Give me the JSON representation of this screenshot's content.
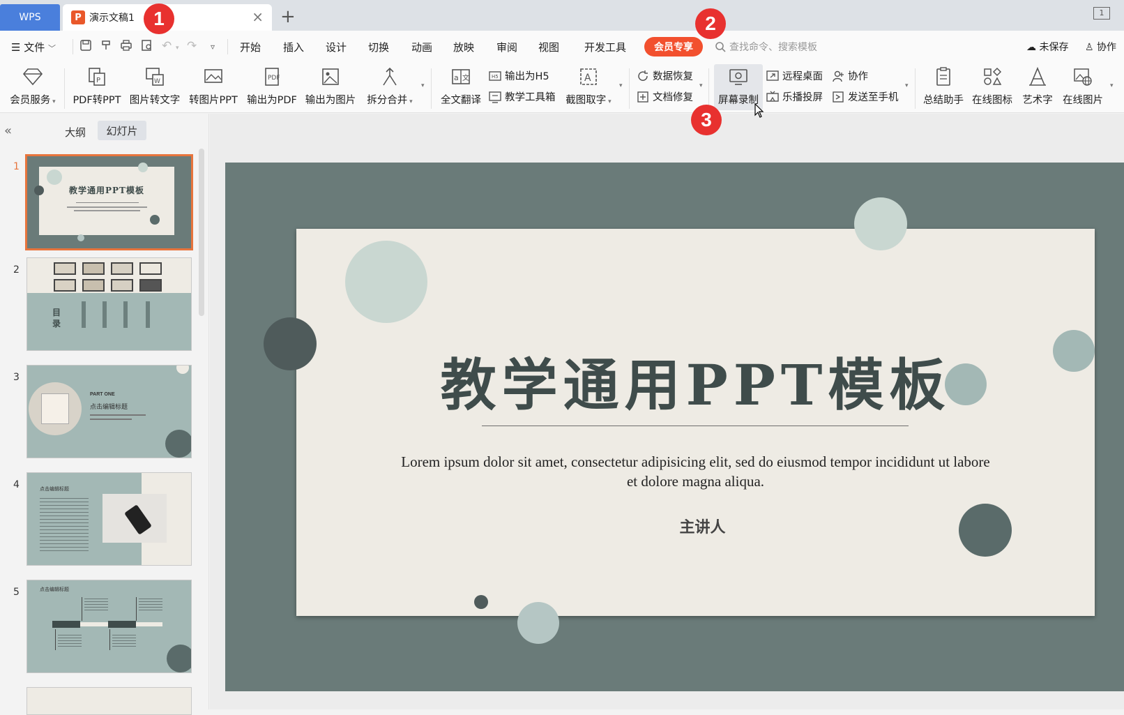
{
  "tabbar": {
    "app_tab": "WPS",
    "doc_tab_title": "演示文稿1",
    "doc_tab_icon": "P"
  },
  "menu": {
    "file": "文件",
    "items": [
      "开始",
      "插入",
      "设计",
      "切换",
      "动画",
      "放映",
      "审阅",
      "视图",
      "开发工具"
    ],
    "member": "会员专享",
    "search_placeholder": "查找命令、搜索模板",
    "unsaved": "未保存",
    "collab": "协作"
  },
  "ribbon": {
    "member_service": "会员服务",
    "pdf_to_ppt": "PDF转PPT",
    "img_to_text": "图片转文字",
    "img_to_ppt": "转图片PPT",
    "export_pdf": "输出为PDF",
    "export_img": "输出为图片",
    "split_merge": "拆分合并",
    "translate": "全文翻译",
    "export_h5": "输出为H5",
    "teach_toolbox": "教学工具箱",
    "ocr": "截图取字",
    "data_recovery": "数据恢复",
    "doc_repair": "文档修复",
    "screen_record": "屏幕录制",
    "remote_desktop": "远程桌面",
    "cast": "乐播投屏",
    "collab": "协作",
    "send_phone": "发送至手机",
    "summary": "总结助手",
    "online_icons": "在线图标",
    "art_text": "艺术字",
    "online_images": "在线图片"
  },
  "badges": [
    "1",
    "2",
    "3"
  ],
  "panel": {
    "collapse": "«",
    "tab_outline": "大纲",
    "tab_slides": "幻灯片",
    "slide_numbers": [
      "1",
      "2",
      "3",
      "4",
      "5"
    ],
    "thumb1_title": "教学通用PPT模板",
    "thumb2_heading": "目录",
    "thumb3_part": "PART ONE",
    "thumb3_title": "点击编辑标题",
    "thumb4_title": "点击编辑标题",
    "thumb5_title": "点击编辑标题"
  },
  "slide": {
    "title": "教学通用PPT模板",
    "body": "Lorem ipsum dolor sit amet, consectetur adipisicing elit, sed do eiusmod tempor incididunt ut labore et dolore magna aliqua.",
    "presenter": "主讲人"
  },
  "colors": {
    "slide_bg": "#6a7b79",
    "card": "#eeebe4",
    "title": "#3f4c4b",
    "accent_orange": "#f2502e",
    "badge_red": "#e8312f",
    "selection": "#e7743c"
  }
}
